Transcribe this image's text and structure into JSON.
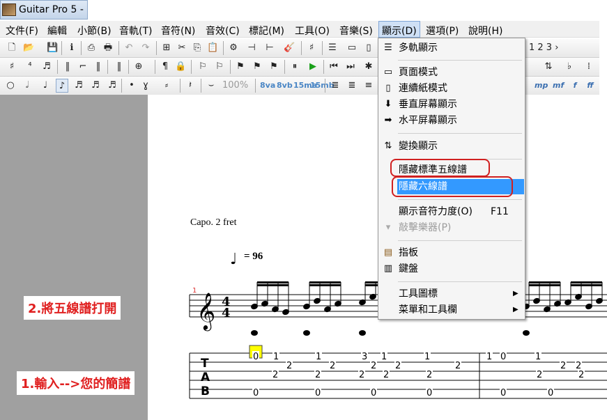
{
  "app": {
    "title": "Guitar Pro 5 -"
  },
  "menubar": {
    "items": [
      "文件(F)",
      "編輯",
      "小節(B)",
      "音軌(T)",
      "音符(N)",
      "音效(C)",
      "標記(M)",
      "工具(O)",
      "音樂(S)",
      "顯示(D)",
      "選項(P)",
      "說明(H)"
    ]
  },
  "toolbar": {
    "zoom": "100%",
    "page_nav": "1 2 3 ›",
    "ottava": [
      "8va",
      "8vb",
      "15ma",
      "15mb"
    ],
    "dynamics": [
      "mp",
      "mf",
      "f",
      "ff"
    ]
  },
  "score": {
    "capo": "Capo. 2 fret",
    "tempo": "= 96",
    "bar_number": "1",
    "time_sig": {
      "num": "4",
      "den": "4"
    },
    "tab_letters": [
      "T",
      "A",
      "B"
    ],
    "tab_numbers": [
      {
        "string": 1,
        "frets": [
          "0",
          "1",
          "1",
          "3",
          "1",
          "1",
          "1",
          "0",
          "1"
        ]
      },
      {
        "string": 2,
        "frets": [
          "2",
          "2",
          "2",
          "2",
          "2",
          "2",
          "2"
        ]
      },
      {
        "string": 3,
        "frets": [
          "2",
          "2",
          "2",
          "2",
          "2",
          "2",
          "2"
        ]
      },
      {
        "string": 5,
        "frets": [
          "0",
          "0",
          "0",
          "0",
          "0",
          "0"
        ]
      }
    ]
  },
  "annotations": {
    "step1": "1.輸入-->您的簡譜",
    "step2": "2.將五線譜打開"
  },
  "dropdown": {
    "items": [
      {
        "icon": "multi-track-icon",
        "label": "多軌顯示"
      },
      {
        "icon": "page-mode-icon",
        "label": "頁面模式"
      },
      {
        "icon": "scroll-mode-icon",
        "label": "連續紙模式"
      },
      {
        "icon": "vertical-screen-icon",
        "label": "垂直屏幕顯示"
      },
      {
        "icon": "horizontal-screen-icon",
        "label": "水平屏幕顯示"
      },
      {
        "icon": "transpose-display-icon",
        "label": "變換顯示"
      },
      {
        "label": "隱藏標準五線譜"
      },
      {
        "label": "隱藏六線譜",
        "highlighted": true
      },
      {
        "label": "顯示音符力度(O)",
        "shortcut": "F11"
      },
      {
        "icon": "percussion-icon",
        "label": "敲擊樂器(P)",
        "disabled": true
      },
      {
        "icon": "fretboard-icon",
        "label": "指板"
      },
      {
        "icon": "keyboard-icon",
        "label": "鍵盤"
      },
      {
        "label": "工具圖標",
        "submenu": true
      },
      {
        "label": "菜單和工具欄",
        "submenu": true
      }
    ]
  },
  "colors": {
    "highlight": "#3399ff",
    "annotation_red": "#e02020",
    "panel_gray": "#a0a0a0",
    "cursor_yellow": "#ffff00"
  }
}
